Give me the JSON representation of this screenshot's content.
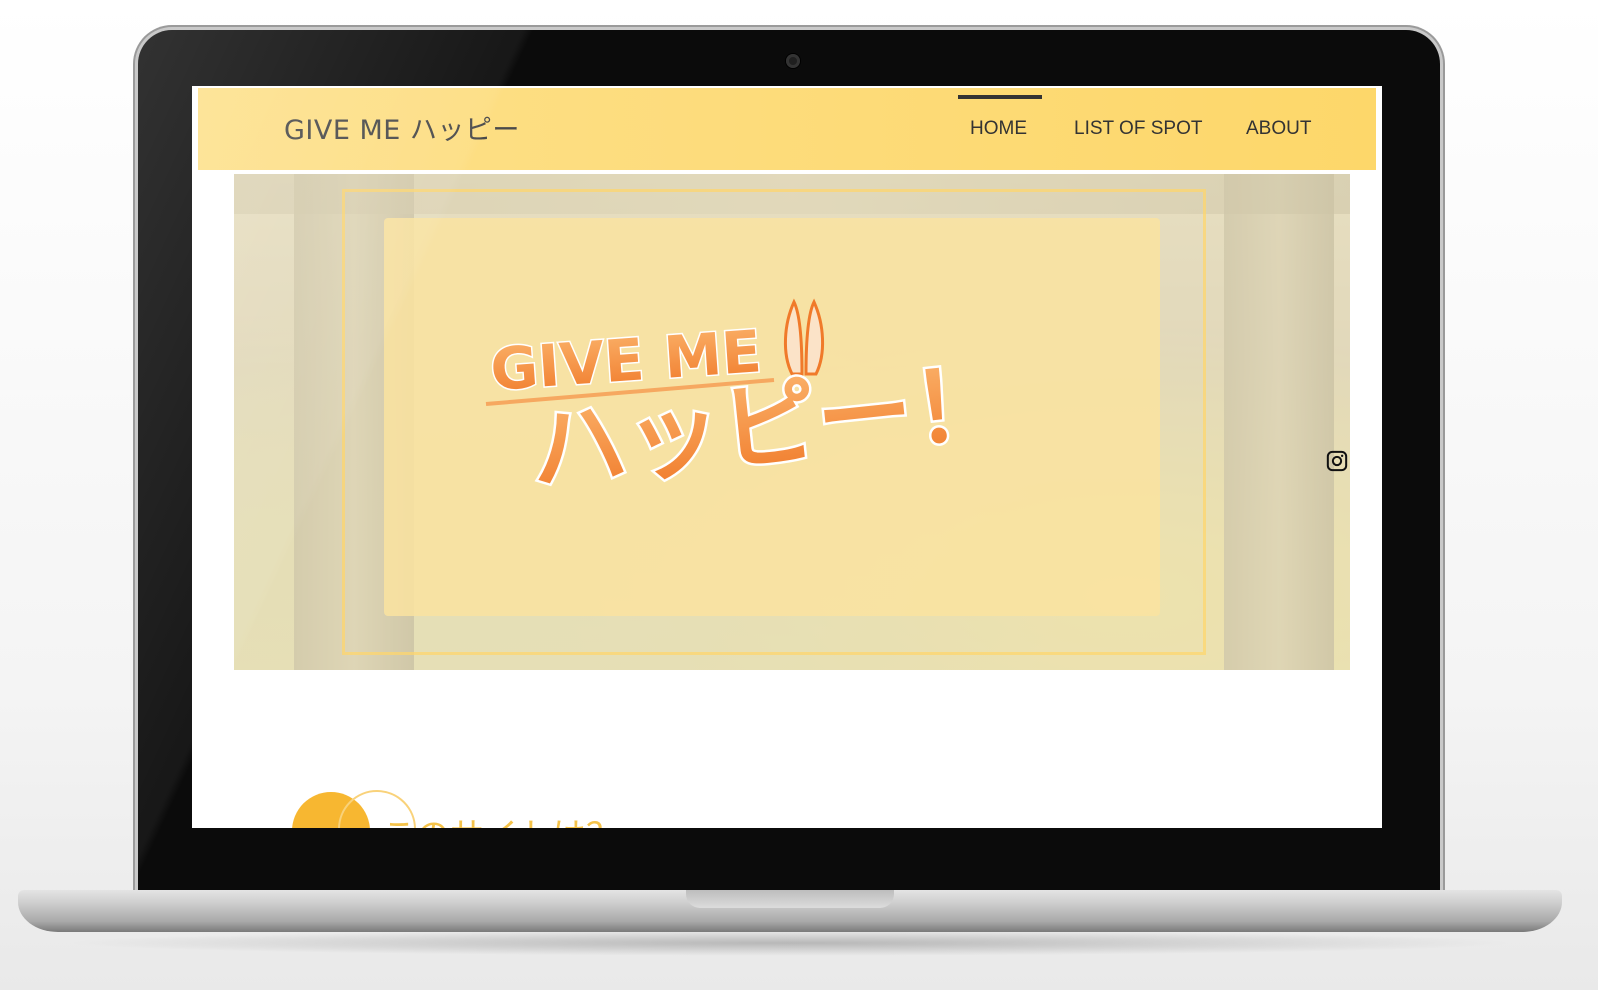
{
  "site": {
    "title": "GIVE ME ハッピー"
  },
  "nav": {
    "items": [
      {
        "label": "HOME",
        "active": true
      },
      {
        "label": "LIST OF SPOT",
        "active": false
      },
      {
        "label": "ABOUT",
        "active": false
      }
    ]
  },
  "hero": {
    "logo_line1": "GIVE ME",
    "logo_line2": "ハッピー！"
  },
  "section": {
    "title": "このサイトは？"
  },
  "colors": {
    "header_yellow": "#fdd76a",
    "logo_orange": "#f5893a",
    "accent_gold": "#f7b731"
  },
  "icons": {
    "social": "instagram-icon",
    "camera": "webcam-icon"
  }
}
